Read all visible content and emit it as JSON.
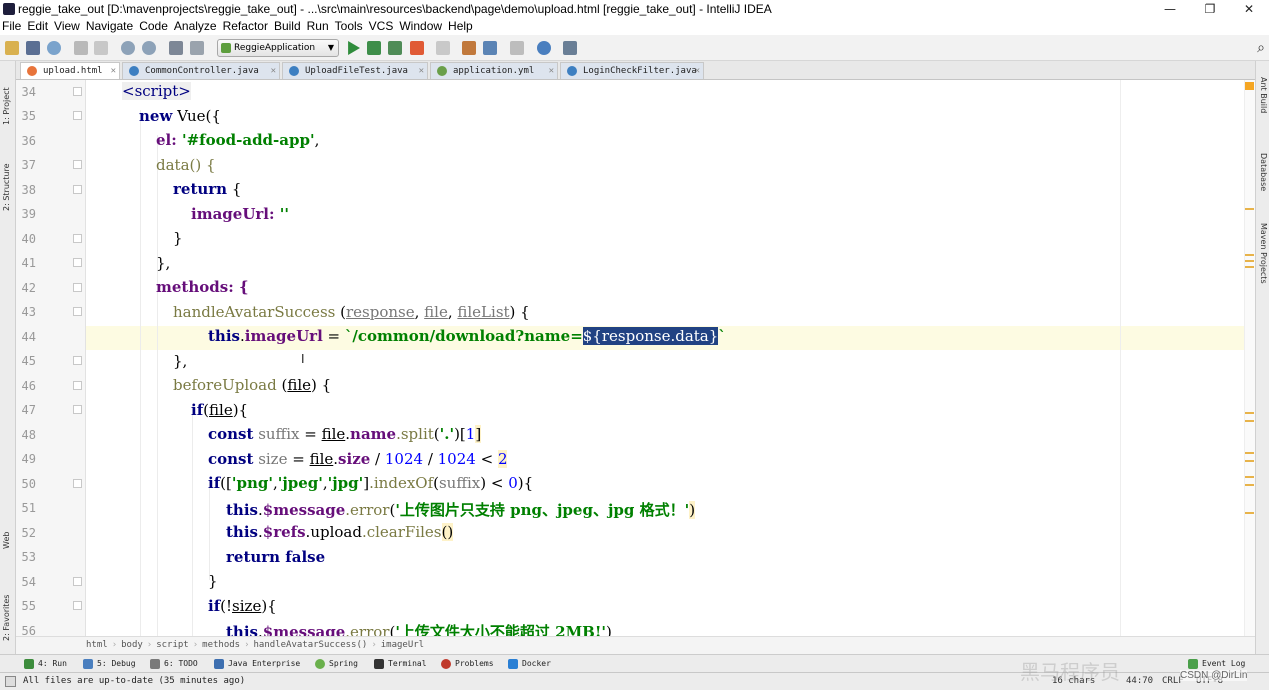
{
  "window": {
    "title": "reggie_take_out [D:\\mavenprojects\\reggie_take_out] - ...\\src\\main\\resources\\backend\\page\\demo\\upload.html [reggie_take_out] - IntelliJ IDEA",
    "minimize": "—",
    "maximize": "❐",
    "close": "✕"
  },
  "menu": [
    "File",
    "Edit",
    "View",
    "Navigate",
    "Code",
    "Analyze",
    "Refactor",
    "Build",
    "Run",
    "Tools",
    "VCS",
    "Window",
    "Help"
  ],
  "toolbar": {
    "run_config": "ReggieApplication",
    "icons": [
      "open-icon",
      "save-icon",
      "sync-icon",
      "undo-icon",
      "redo-icon",
      "zoom-in-icon",
      "zoom-out-icon",
      "build-icon",
      "build-project-icon",
      "run-icon",
      "debug-icon",
      "coverage-icon",
      "stop-icon",
      "vcs-icon",
      "settings-icon",
      "structure-icon",
      "sdk-icon",
      "help-icon",
      "plugins-icon"
    ]
  },
  "left_tool_tabs": [
    "1: Project",
    "2: Structure",
    "Web",
    "2: Favorites"
  ],
  "right_tool_tabs": [
    "Ant Build",
    "Database",
    "Maven Projects"
  ],
  "tabs": [
    {
      "label": "upload.html",
      "active": true,
      "color": "#e8743b"
    },
    {
      "label": "CommonController.java",
      "active": false,
      "color": "#3d7fc1"
    },
    {
      "label": "UploadFileTest.java",
      "active": false,
      "color": "#3d7fc1"
    },
    {
      "label": "application.yml",
      "active": false,
      "color": "#6a9f4a"
    },
    {
      "label": "LoginCheckFilter.java",
      "active": false,
      "color": "#3d7fc1"
    }
  ],
  "editor": {
    "line_numbers": [
      "34",
      "35",
      "36",
      "37",
      "38",
      "39",
      "40",
      "41",
      "42",
      "43",
      "44",
      "45",
      "46",
      "47",
      "48",
      "49",
      "50",
      "51",
      "52",
      "53",
      "54",
      "55",
      "56"
    ],
    "current_line": "44",
    "code": {
      "l34": "<script>",
      "l35_kw": "new",
      "l35_rest": " Vue({",
      "l36_a": "el: ",
      "l36_str": "'#food-add-app'",
      "l36_b": ",",
      "l37": "data() {",
      "l38_kw": "return",
      "l38_b": " {",
      "l39_a": "imageUrl: ",
      "l39_str": "''",
      "l40": "}",
      "l41": "},",
      "l42": "methods: {",
      "l43_fn": "handleAvatarSuccess",
      "l43_a": " (",
      "l43_p1": "response",
      "l43_c1": ", ",
      "l43_p2": "file",
      "l43_c2": ", ",
      "l43_p3": "fileList",
      "l43_b": ") {",
      "l44_this": "this",
      "l44_dot": ".",
      "l44_prop": "imageUrl",
      "l44_eq": " = ",
      "l44_str": "`/common/download?name=",
      "l44_sel": "${response.data}",
      "l44_end": "`",
      "l45": "},",
      "l46_fn": "beforeUpload",
      "l46_a": " (",
      "l46_p": "file",
      "l46_b": ") {",
      "l47_kw": "if",
      "l47_a": "(",
      "l47_v": "file",
      "l47_b": "){",
      "l48_kw": "const",
      "l48_v": " suffix",
      "l48_eq": " = ",
      "l48_f": "file",
      "l48_dot": ".",
      "l48_prop": "name",
      "l48_fn": ".split",
      "l48_a": "(",
      "l48_str": "'.'",
      "l48_b": ")[",
      "l48_num": "1",
      "l48_c": "]",
      "l49_kw": "const",
      "l49_v": " size",
      "l49_eq": " = ",
      "l49_f": "file",
      "l49_dot": ".",
      "l49_prop": "size",
      "l49_op1": " / ",
      "l49_n1": "1024",
      "l49_op2": " / ",
      "l49_n2": "1024",
      "l49_op3": " < ",
      "l49_n3": "2",
      "l50_kw": "if",
      "l50_a": "([",
      "l50_s1": "'png'",
      "l50_c1": ",",
      "l50_s2": "'jpeg'",
      "l50_c2": ",",
      "l50_s3": "'jpg'",
      "l50_b": "]",
      "l50_fn": ".indexOf",
      "l50_c": "(",
      "l50_v": "suffix",
      "l50_d": ") ",
      "l50_op": "<",
      "l50_e": " ",
      "l50_num": "0",
      "l50_f": "){",
      "l51_this": "this",
      "l51_dot": ".",
      "l51_prop": "$message",
      "l51_fn": ".error",
      "l51_a": "(",
      "l51_str": "'上传图片只支持 png、jpeg、jpg 格式！'",
      "l51_b": ")",
      "l52_this": "this",
      "l52_dot": ".",
      "l52_prop": "$refs",
      "l52_mid": ".upload",
      "l52_fn": ".clearFiles",
      "l52_b": "()",
      "l53_kw": "return false",
      "l54": "}",
      "l55_kw": "if",
      "l55_a": "(!",
      "l55_v": "size",
      "l55_b": "){",
      "l56_this": "this",
      "l56_dot": ".",
      "l56_prop": "$message",
      "l56_fn": ".error",
      "l56_a": "(",
      "l56_str": "'上传文件大小不能超过 2MB!'",
      "l56_b": ")"
    }
  },
  "breadcrumb": [
    "html",
    "body",
    "script",
    "methods",
    "handleAvatarSuccess()",
    "imageUrl"
  ],
  "tool_windows": [
    {
      "label": "4: Run",
      "color": "#3c8c3c"
    },
    {
      "label": "5: Debug",
      "color": "#4a7fbf"
    },
    {
      "label": "6: TODO",
      "color": "#7a7a7a"
    },
    {
      "label": "Java Enterprise",
      "color": "#3d6fb0"
    },
    {
      "label": "Spring",
      "color": "#6ab04c"
    },
    {
      "label": "Terminal",
      "color": "#333333"
    },
    {
      "label": "Problems",
      "color": "#c0392b"
    },
    {
      "label": "Docker",
      "color": "#2a7fd4"
    },
    {
      "label": "Event Log",
      "color": "#4a9f4a"
    }
  ],
  "status": {
    "message": "All files are up-to-date (35 minutes ago)",
    "chars": "16 chars",
    "position": "44:70",
    "crlf": "CRLF",
    "encoding": "UTF-8"
  },
  "overlay": {
    "watermark": "黑马程序员",
    "credit": "CSDN @DirLin"
  }
}
